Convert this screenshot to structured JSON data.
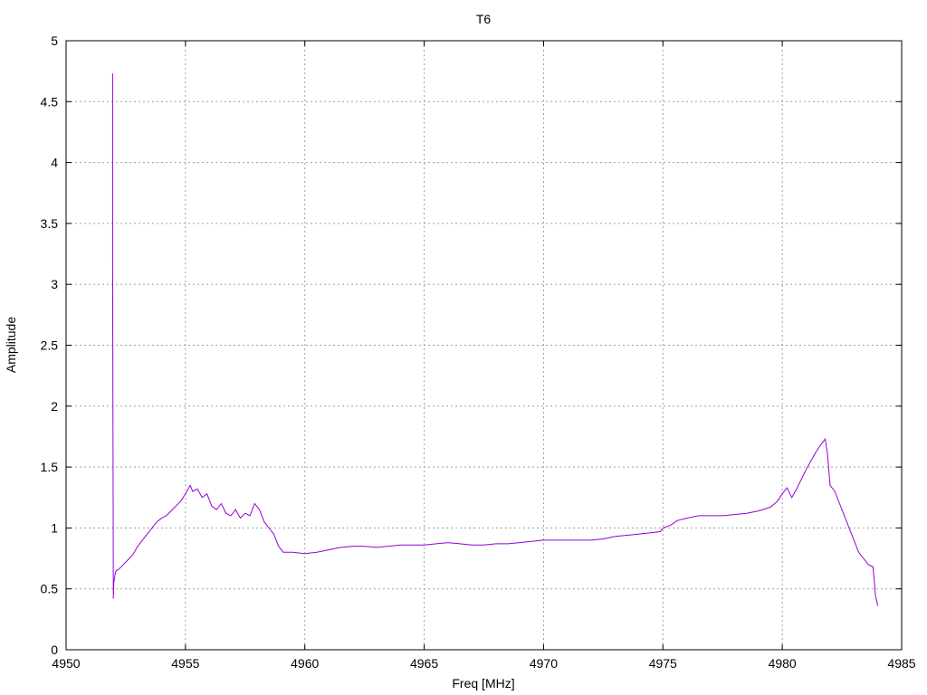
{
  "chart_data": {
    "type": "line",
    "title": "T6",
    "xlabel": "Freq [MHz]",
    "ylabel": "Amplitude",
    "xlim": [
      4950,
      4985
    ],
    "ylim": [
      0,
      5
    ],
    "xticks": [
      "4950",
      "4955",
      "4960",
      "4965",
      "4970",
      "4975",
      "4980",
      "4985"
    ],
    "yticks": [
      "0",
      "0.5",
      "1",
      "1.5",
      "2",
      "2.5",
      "3",
      "3.5",
      "4",
      "4.5",
      "5"
    ],
    "grid": true,
    "legend": "none",
    "series": [
      {
        "color": "#9400d3",
        "x": [
          4951.95,
          4951.95,
          4951.97,
          4951.98,
          4952.0,
          4952.05,
          4952.1,
          4952.2,
          4952.4,
          4952.6,
          4952.8,
          4953.0,
          4953.2,
          4953.4,
          4953.6,
          4953.8,
          4954.0,
          4954.2,
          4954.4,
          4954.6,
          4954.8,
          4955.0,
          4955.2,
          4955.3,
          4955.5,
          4955.7,
          4955.9,
          4956.1,
          4956.3,
          4956.5,
          4956.7,
          4956.9,
          4957.1,
          4957.3,
          4957.5,
          4957.7,
          4957.9,
          4958.1,
          4958.3,
          4958.5,
          4958.7,
          4958.9,
          4959.1,
          4959.5,
          4960.0,
          4960.5,
          4961.0,
          4961.5,
          4962.0,
          4962.5,
          4963.0,
          4963.5,
          4964.0,
          4964.5,
          4965.0,
          4965.5,
          4966.0,
          4966.5,
          4967.0,
          4967.5,
          4968.0,
          4968.5,
          4969.0,
          4969.5,
          4970.0,
          4970.5,
          4971.0,
          4971.5,
          4972.0,
          4972.5,
          4973.0,
          4973.5,
          4974.0,
          4974.5,
          4974.9,
          4975.0,
          4975.3,
          4975.6,
          4976.0,
          4976.5,
          4977.0,
          4977.5,
          4978.0,
          4978.5,
          4979.0,
          4979.5,
          4979.8,
          4980.0,
          4980.2,
          4980.4,
          4980.6,
          4980.8,
          4981.0,
          4981.2,
          4981.4,
          4981.6,
          4981.8,
          4981.9,
          4982.0,
          4982.2,
          4982.4,
          4982.6,
          4982.8,
          4983.0,
          4983.2,
          4983.4,
          4983.6,
          4983.8,
          4983.9,
          4984.0
        ],
        "y": [
          4.73,
          3.2,
          1.2,
          0.42,
          0.55,
          0.62,
          0.65,
          0.66,
          0.7,
          0.74,
          0.78,
          0.85,
          0.9,
          0.95,
          1.0,
          1.05,
          1.08,
          1.1,
          1.14,
          1.18,
          1.22,
          1.28,
          1.35,
          1.3,
          1.32,
          1.25,
          1.28,
          1.18,
          1.15,
          1.2,
          1.12,
          1.1,
          1.15,
          1.08,
          1.12,
          1.1,
          1.2,
          1.15,
          1.05,
          1.0,
          0.95,
          0.85,
          0.8,
          0.8,
          0.79,
          0.8,
          0.82,
          0.84,
          0.85,
          0.85,
          0.84,
          0.85,
          0.86,
          0.86,
          0.86,
          0.87,
          0.88,
          0.87,
          0.86,
          0.86,
          0.87,
          0.87,
          0.88,
          0.89,
          0.9,
          0.9,
          0.9,
          0.9,
          0.9,
          0.91,
          0.93,
          0.94,
          0.95,
          0.96,
          0.97,
          1.0,
          1.02,
          1.06,
          1.08,
          1.1,
          1.1,
          1.1,
          1.11,
          1.12,
          1.14,
          1.17,
          1.22,
          1.28,
          1.33,
          1.25,
          1.32,
          1.4,
          1.48,
          1.55,
          1.62,
          1.68,
          1.73,
          1.6,
          1.35,
          1.3,
          1.2,
          1.1,
          1.0,
          0.9,
          0.8,
          0.75,
          0.7,
          0.68,
          0.45,
          0.36
        ]
      }
    ]
  }
}
